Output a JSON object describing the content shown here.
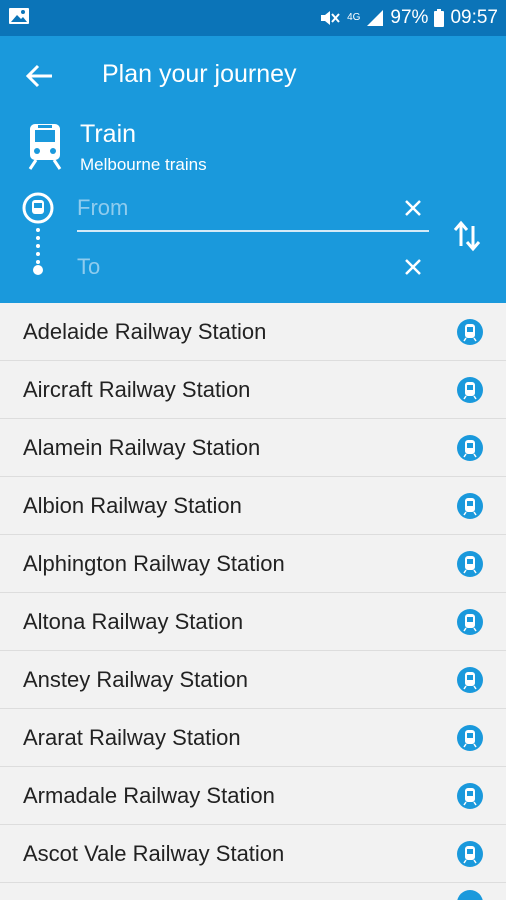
{
  "status_bar": {
    "network": "4G",
    "battery": "97%",
    "time": "09:57",
    "icons": [
      "image-icon",
      "mute-icon",
      "signal-icon",
      "battery-icon"
    ]
  },
  "header": {
    "title": "Plan your journey",
    "mode": "Train",
    "subtitle": "Melbourne trains",
    "from_placeholder": "From",
    "to_placeholder": "To",
    "background": "#1a99dc",
    "statusbar_color": "#0b74b8"
  },
  "stations": [
    {
      "label": "Adelaide Railway Station"
    },
    {
      "label": "Aircraft Railway Station"
    },
    {
      "label": "Alamein Railway Station"
    },
    {
      "label": "Albion Railway Station"
    },
    {
      "label": "Alphington Railway Station"
    },
    {
      "label": "Altona Railway Station"
    },
    {
      "label": "Anstey Railway Station"
    },
    {
      "label": "Ararat Railway Station"
    },
    {
      "label": "Armadale Railway Station"
    },
    {
      "label": "Ascot Vale Railway Station"
    }
  ],
  "colors": {
    "station_icon": "#1a99dc",
    "list_text": "#222222"
  }
}
